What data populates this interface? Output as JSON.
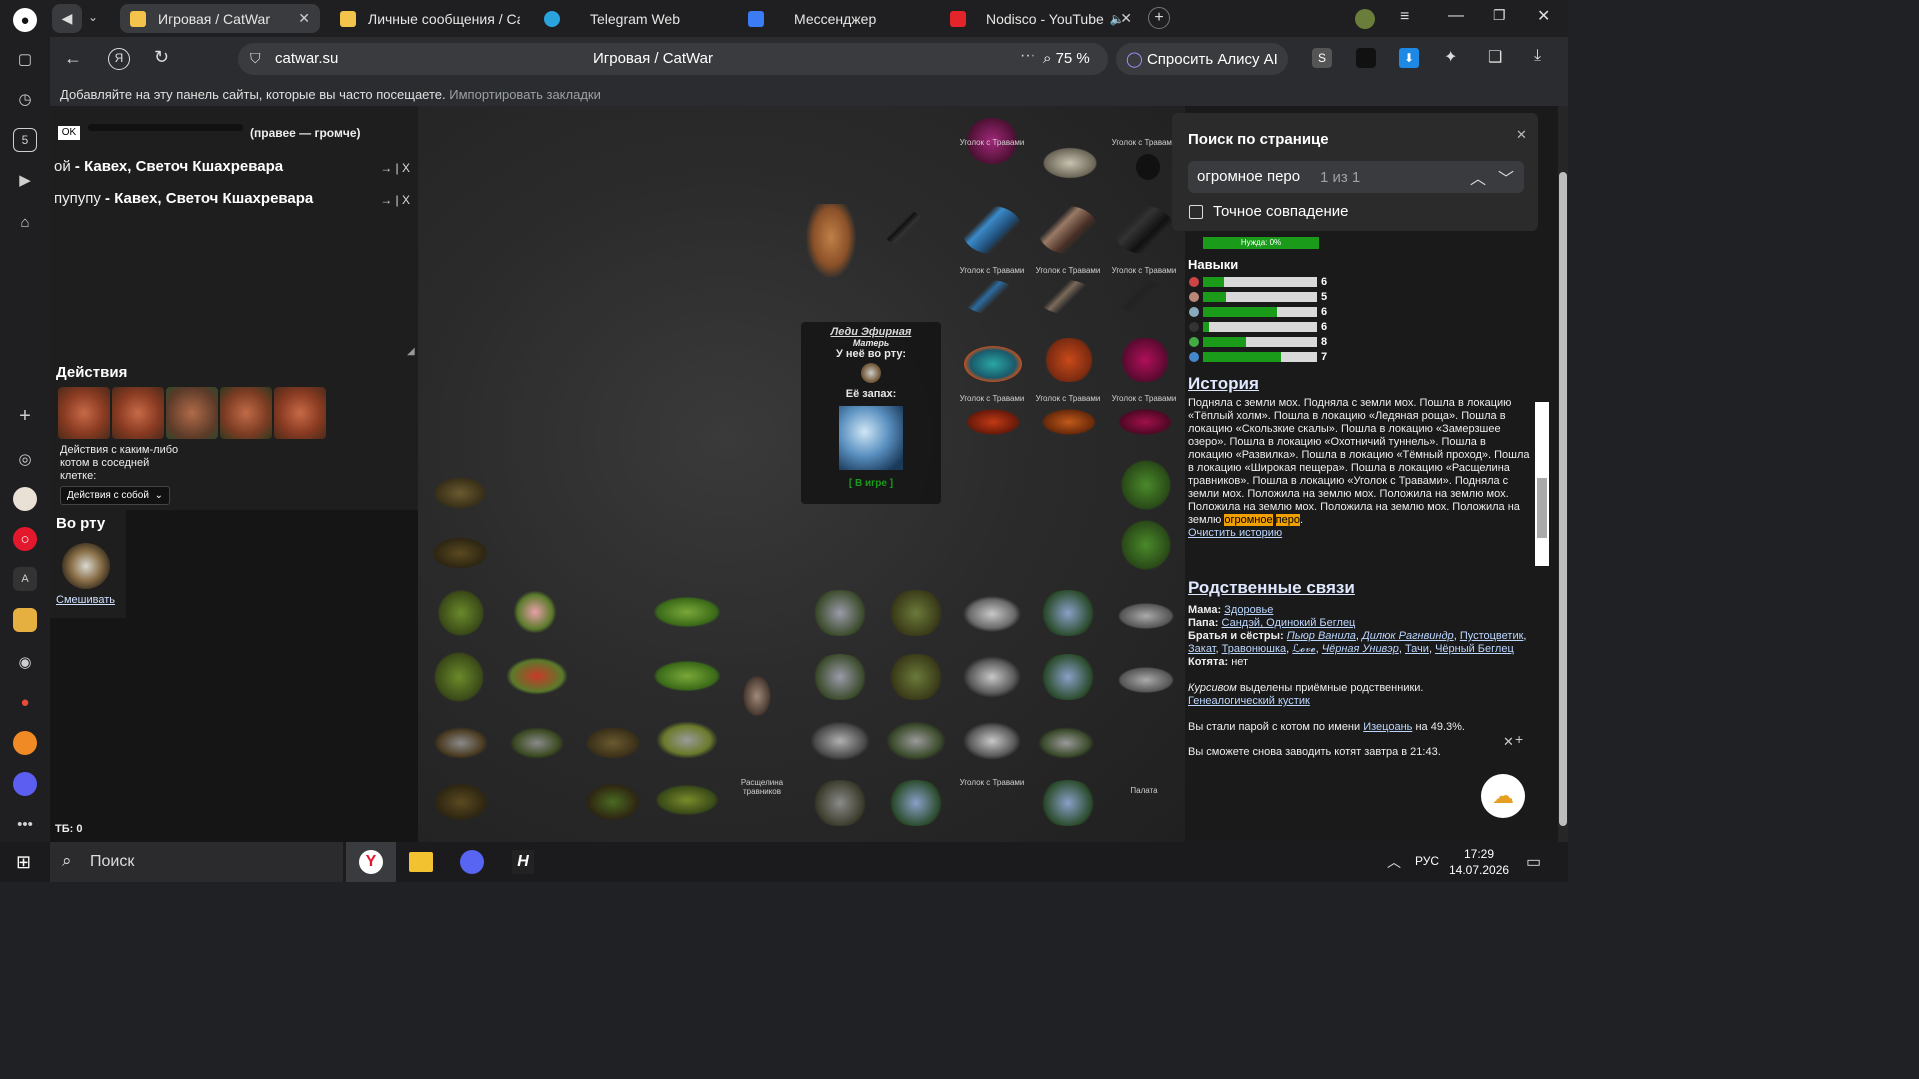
{
  "tabs": [
    {
      "title": "Игровая / CatWar",
      "active": true
    },
    {
      "title": "Личные сообщения / CatW",
      "active": false
    },
    {
      "title": "Telegram Web",
      "active": false
    },
    {
      "title": "Мессенджер",
      "active": false
    },
    {
      "title": "Nodisco - YouTube",
      "active": false
    }
  ],
  "address": {
    "url": "catwar.su",
    "page_title": "Игровая / CatWar",
    "zoom": "75 %",
    "alice": "Спросить Алису AI"
  },
  "bookmarks": {
    "hint": "Добавляйте на эту панель сайты, которые вы часто посещаете.",
    "import": "Импортировать закладки"
  },
  "left": {
    "ok": "OK",
    "volume_hint": "(правее — громче)",
    "chat": [
      {
        "prefix": "ой",
        "text": "Кавех, Светоч Кшахревара",
        "ctl": "→ | X"
      },
      {
        "prefix": "пупупу",
        "text": "Кавех, Светоч Кшахревара",
        "ctl": "→ | X"
      }
    ],
    "actions_title": "Действия",
    "neighbor_label": "Действия с каким-либо котом в соседней клетке:",
    "neighbor_select": "Действия с собой",
    "mouth_title": "Во рту",
    "mix_link": "Смешивать",
    "tb": "ТБ: 0"
  },
  "map": {
    "cat_card": {
      "name": "Леди Эфирная",
      "role": "Матерь",
      "mouth_label": "У неё во рту:",
      "smell_label": "Её запах:",
      "status": "[ В игре ]"
    },
    "labels": {
      "ugolok": "Уголок с Травами",
      "rasshchelina": "Расщелина травников",
      "palata": "Палата"
    }
  },
  "right": {
    "need": "Нужда: 0%",
    "skills_title": "Навыки",
    "skills": [
      {
        "value": 6,
        "fill": 0.18
      },
      {
        "value": 5,
        "fill": 0.2
      },
      {
        "value": 6,
        "fill": 0.65
      },
      {
        "value": 6,
        "fill": 0.05
      },
      {
        "value": 8,
        "fill": 0.38
      },
      {
        "value": 7,
        "fill": 0.68
      }
    ],
    "history_title": "История",
    "history_text": "Подняла с земли мох. Подняла с земли мох. Пошла в локацию «Тёплый холм». Пошла в локацию «Ледяная роща». Пошла в локацию «Скользкие скалы». Пошла в локацию «Замерзшее озеро». Пошла в локацию «Охотничий туннель». Пошла в локацию «Развилка». Пошла в локацию «Тёмный проход». Пошла в локацию «Широкая пещера». Пошла в локацию «Расщелина травников». Пошла в локацию «Уголок с Травами». Подняла с земли мох. Положила на землю мох. Положила на землю мох. Положила на землю мох. Положила на землю мох. Положила на землю",
    "history_hl1": "огромное",
    "history_hl2": "перо",
    "clear_history": "Очистить историю",
    "relatives_title": "Родственные связи",
    "mama_label": "Мама:",
    "mama": "Здоровье",
    "papa_label": "Папа:",
    "papa": "Сандэй, Одинокий Беглец",
    "siblings_label": "Братья и сёстры:",
    "siblings": [
      "Пьюр Ванила",
      "Дилюк Рагнвиндр",
      "Пустоцветик",
      "Закат",
      "Травонюшка",
      "ℒ𝓸𝓋𝓮",
      "Чёрная Унивэр",
      "Тачи",
      "Чёрный Беглец"
    ],
    "kittens_label": "Котята:",
    "kittens": "нет",
    "adopted_note_italic": "Курсивом",
    "adopted_note_rest": "выделены приёмные родственники.",
    "tree_link": "Генеалогический кустик",
    "pair_prefix": "Вы стали парой с котом по имени",
    "pair_name": "Изецоань",
    "pair_suffix": "на 49.3%.",
    "kits_again": "Вы сможете снова заводить котят завтра в 21:43."
  },
  "find": {
    "title": "Поиск по странице",
    "query": "огромное перо",
    "count": "1 из 1",
    "exact": "Точное совпадение"
  },
  "taskbar": {
    "search": "Поиск",
    "lang": "РУС",
    "time": "17:29",
    "date": "14.07.2026"
  },
  "colors": {
    "accent_green": "#1a9b1a",
    "highlight": "#f0a000",
    "link": "#bcd7ff"
  }
}
